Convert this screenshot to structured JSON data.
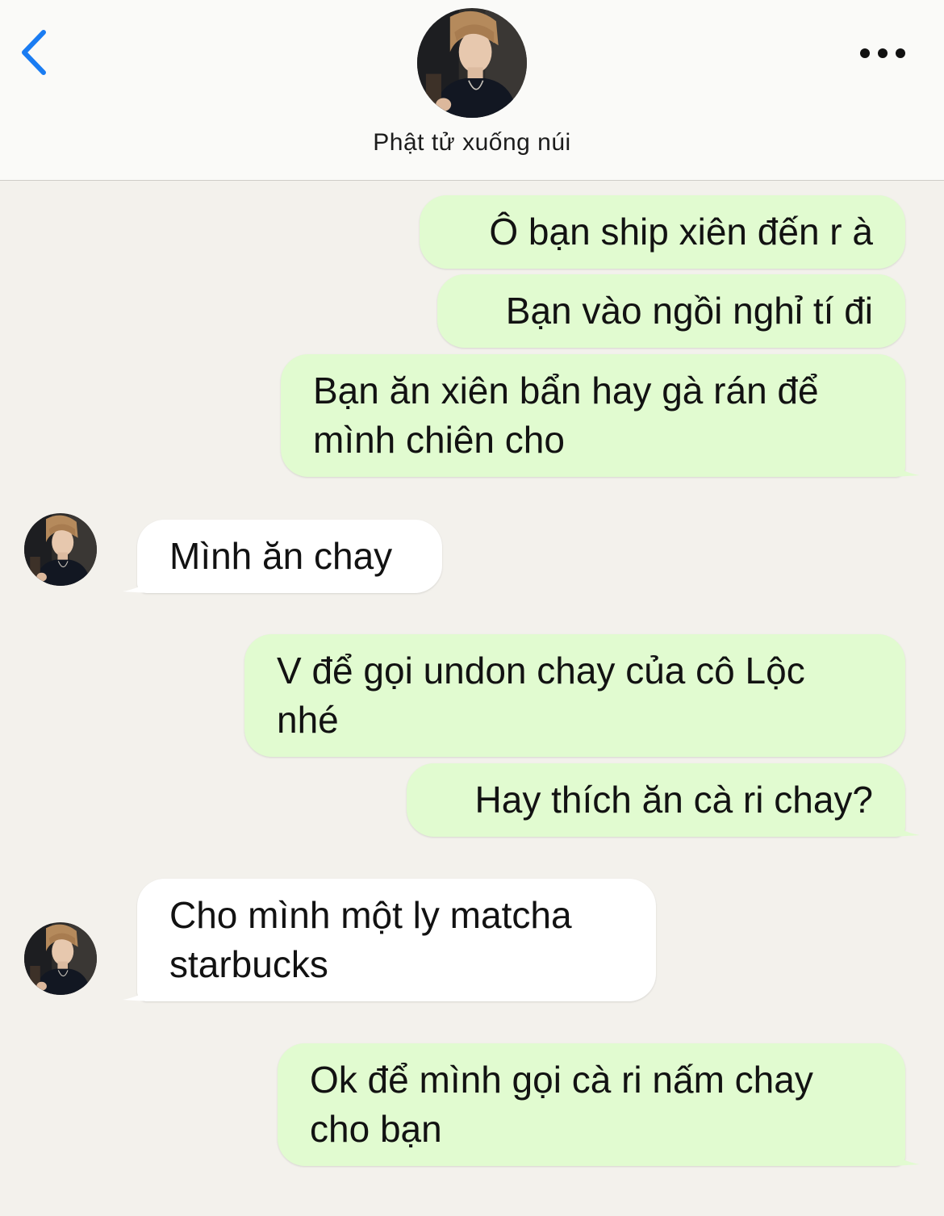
{
  "header": {
    "contact_name": "Phật tử xuống núi",
    "back_icon": "chevron-left-icon",
    "more_icon": "ellipsis-icon",
    "accent_color": "#1a7cf2"
  },
  "colors": {
    "background": "#f3f1ec",
    "outgoing_bubble": "#e1fbd0",
    "incoming_bubble": "#ffffff"
  },
  "messages": [
    {
      "direction": "outgoing",
      "text": "Ô bạn ship xiên đến r à"
    },
    {
      "direction": "outgoing",
      "text": "Bạn vào ngồi nghỉ tí đi"
    },
    {
      "direction": "outgoing",
      "text": "Bạn ăn xiên bẩn hay gà rán để mình chiên cho"
    },
    {
      "direction": "incoming",
      "text": "Mình ăn chay"
    },
    {
      "direction": "outgoing",
      "text": "V để gọi undon chay của cô Lộc nhé"
    },
    {
      "direction": "outgoing",
      "text": "Hay thích ăn cà ri chay?"
    },
    {
      "direction": "incoming",
      "text": "Cho mình một ly matcha starbucks"
    },
    {
      "direction": "outgoing",
      "text": "Ok để mình gọi cà ri nấm chay cho bạn"
    }
  ]
}
